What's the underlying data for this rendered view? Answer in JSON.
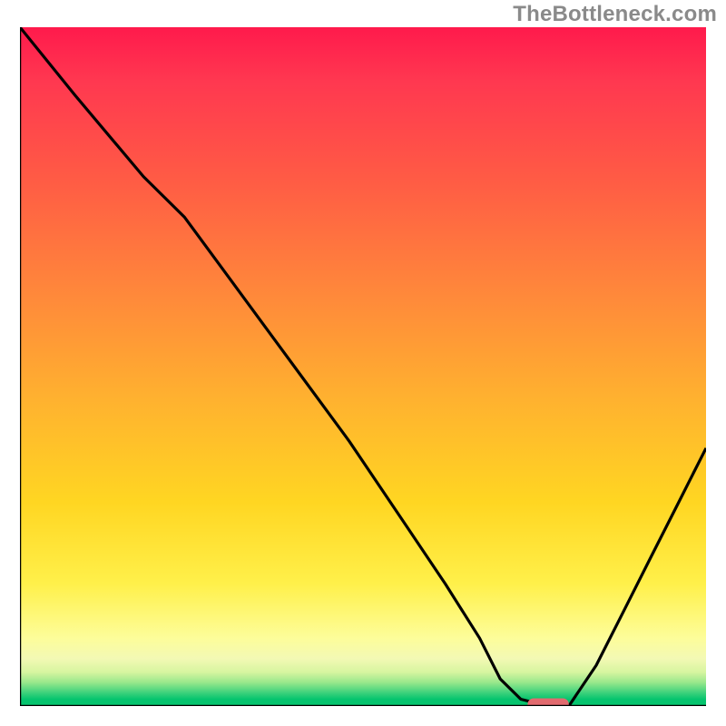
{
  "watermark": "TheBottleneck.com",
  "domain": "Chart",
  "colors": {
    "gradient_top": "#ff1a4c",
    "gradient_mid": "#ffd622",
    "gradient_bottom": "#06c46e",
    "curve": "#000000",
    "axes": "#000000",
    "marker": "#e26b6f",
    "watermark_text": "#8a8a8a"
  },
  "chart_data": {
    "type": "line",
    "title": "",
    "xlabel": "",
    "ylabel": "",
    "xlim": [
      0,
      100
    ],
    "ylim": [
      0,
      100
    ],
    "grid": false,
    "legend": false,
    "series": [
      {
        "name": "bottleneck-curve",
        "x": [
          0,
          8,
          18,
          24,
          32,
          40,
          48,
          56,
          62,
          67,
          70,
          73,
          77,
          80,
          84,
          88,
          92,
          96,
          100
        ],
        "y": [
          100,
          90,
          78,
          72,
          61,
          50,
          39,
          27,
          18,
          10,
          4,
          1,
          0,
          0,
          6,
          14,
          22,
          30,
          38
        ]
      }
    ],
    "marker": {
      "name": "optimal-point",
      "x_range": [
        74,
        80
      ],
      "y": 0,
      "color": "#e26b6f",
      "shape": "rounded-bar"
    },
    "background_gradient": {
      "orientation": "vertical",
      "stops": [
        {
          "pos": 0.0,
          "color": "#ff1a4c"
        },
        {
          "pos": 0.4,
          "color": "#ff8a3a"
        },
        {
          "pos": 0.7,
          "color": "#ffd622"
        },
        {
          "pos": 0.9,
          "color": "#fdfd9a"
        },
        {
          "pos": 0.97,
          "color": "#9ae88c"
        },
        {
          "pos": 1.0,
          "color": "#06c46e"
        }
      ]
    }
  }
}
